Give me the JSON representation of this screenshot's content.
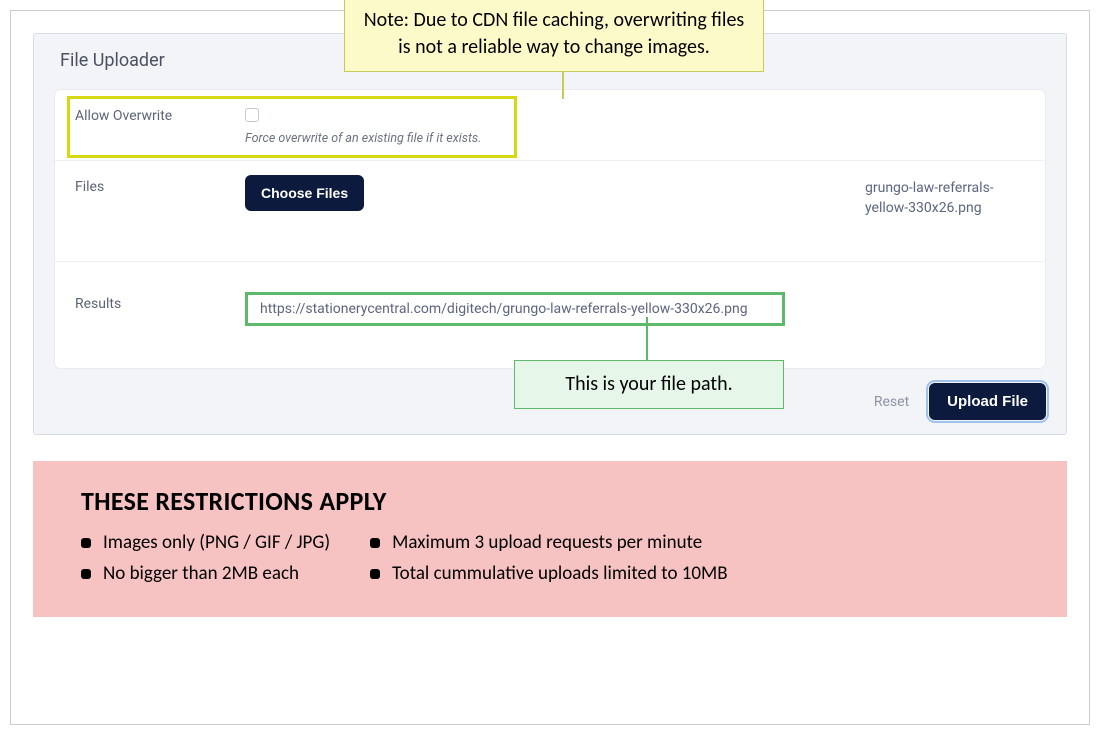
{
  "panel": {
    "title": "File Uploader"
  },
  "overwrite": {
    "label": "Allow Overwrite",
    "help": "Force overwrite of an existing file if it exists."
  },
  "files": {
    "label": "Files",
    "button": "Choose Files",
    "selected_name": "grungo-law-referrals-yellow-330x26.png"
  },
  "results": {
    "label": "Results",
    "url": "https://stationerycentral.com/digitech/grungo-law-referrals-yellow-330x26.png"
  },
  "actions": {
    "reset": "Reset",
    "upload": "Upload File"
  },
  "callouts": {
    "cdn_note": "Note: Due to CDN file caching, overwriting files is not a reliable way to change images.",
    "file_path": "This is your file path."
  },
  "restrictions": {
    "heading": "THESE RESTRICTIONS APPLY",
    "col1": [
      "Images only (PNG / GIF / JPG)",
      "No bigger than 2MB each"
    ],
    "col2": [
      "Maximum 3 upload requests per minute",
      "Total cummulative uploads limited to 10MB"
    ]
  }
}
